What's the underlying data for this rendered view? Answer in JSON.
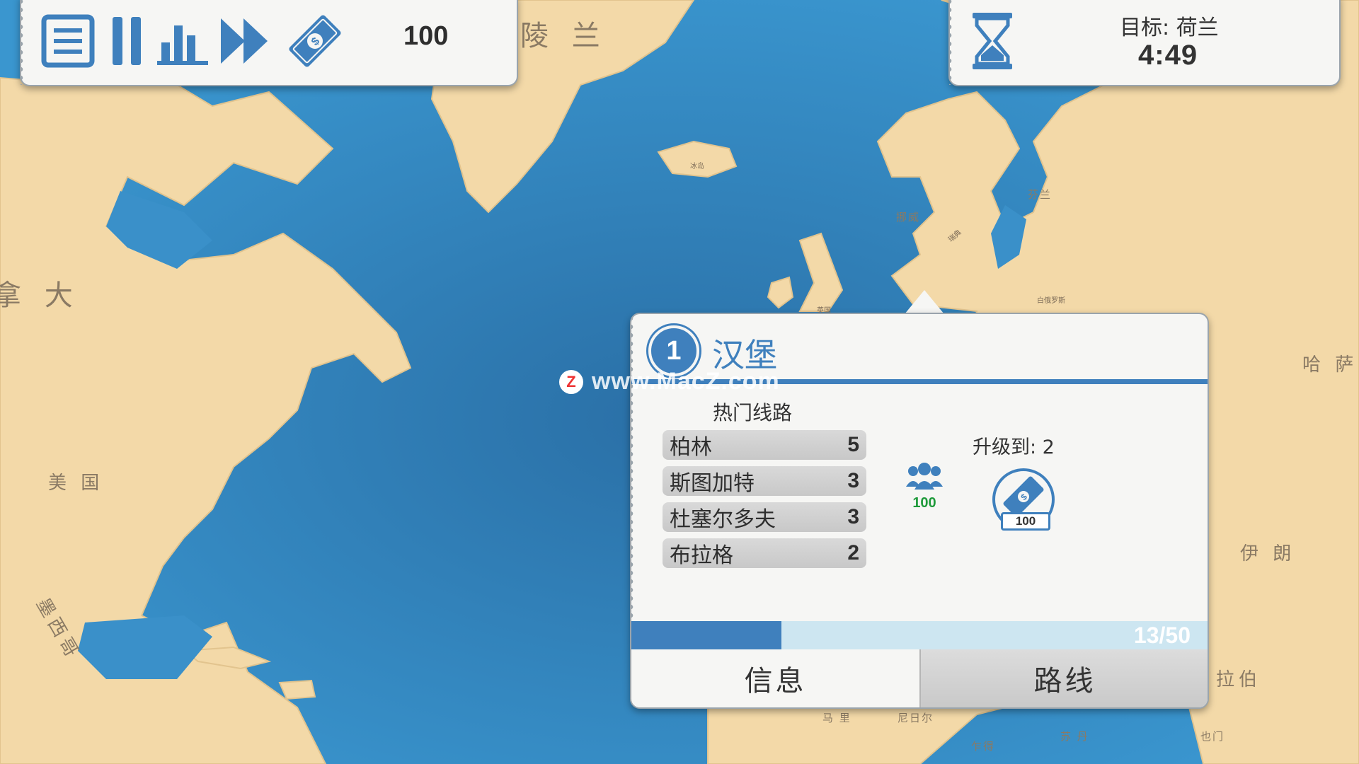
{
  "toolbar": {
    "money": "100",
    "icons": [
      "menu-icon",
      "pause-icon",
      "stats-icon",
      "fast-forward-icon",
      "money-icon"
    ]
  },
  "goal": {
    "label": "目标: 荷兰",
    "time": "4:49"
  },
  "map_labels": {
    "greenland": "陵 兰",
    "canada": "拿 大",
    "usa": "美 国",
    "mexico": "墨西哥",
    "iceland": "冰岛",
    "norway": "挪威",
    "sweden": "瑞典",
    "finland": "芬兰",
    "belarus": "白俄罗斯",
    "uk": "英国",
    "kazakhstan": "哈 萨",
    "iran": "伊 朗",
    "arabia": "拉伯",
    "mali": "马 里",
    "niger": "尼日尔",
    "chad": "乍得",
    "sudan": "苏 丹",
    "yemen": "也门"
  },
  "city": {
    "rank": "1",
    "name": "汉堡",
    "routes_title": "热门线路",
    "routes": [
      {
        "city": "柏林",
        "count": "5"
      },
      {
        "city": "斯图加特",
        "count": "3"
      },
      {
        "city": "杜塞尔多夫",
        "count": "3"
      },
      {
        "city": "布拉格",
        "count": "2"
      }
    ],
    "passengers": "100",
    "upgrade_label": "升级到:  2",
    "upgrade_cost": "100",
    "progress_text": "13/50",
    "progress_fraction": 0.26,
    "tabs": {
      "info": "信息",
      "routes": "路线"
    }
  },
  "watermark": {
    "logo": "Z",
    "text": "www.MacZ.com"
  },
  "colors": {
    "ocean": "#2f86bf",
    "land": "#f3d9a8",
    "accent": "#3f80bd",
    "passenger_green": "#1e9a3a"
  }
}
